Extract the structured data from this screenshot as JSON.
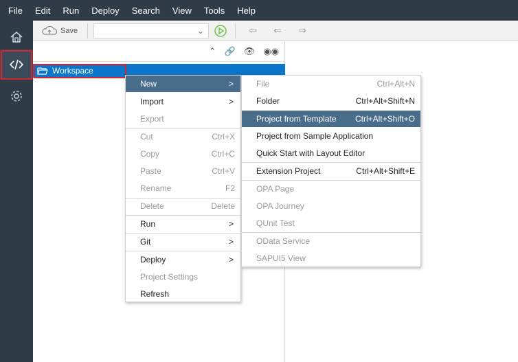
{
  "menubar": [
    "File",
    "Edit",
    "Run",
    "Deploy",
    "Search",
    "View",
    "Tools",
    "Help"
  ],
  "sidebar": {
    "icons": [
      "home-icon",
      "code-icon",
      "gear-icon"
    ],
    "active": "code-icon"
  },
  "toolbar": {
    "save_label": "Save",
    "run_config_value": ""
  },
  "tree": {
    "workspace_label": "Workspace"
  },
  "context_menu": [
    {
      "label": "New",
      "shortcut": "",
      "submenu": true,
      "enabled": true,
      "highlighted": true
    },
    {
      "label": "Import",
      "shortcut": "",
      "submenu": true,
      "enabled": true
    },
    {
      "label": "Export",
      "shortcut": "",
      "submenu": false,
      "enabled": false
    },
    {
      "label": "Cut",
      "shortcut": "Ctrl+X",
      "submenu": false,
      "enabled": false
    },
    {
      "label": "Copy",
      "shortcut": "Ctrl+C",
      "submenu": false,
      "enabled": false
    },
    {
      "label": "Paste",
      "shortcut": "Ctrl+V",
      "submenu": false,
      "enabled": false
    },
    {
      "label": "Rename",
      "shortcut": "F2",
      "submenu": false,
      "enabled": false
    },
    {
      "label": "Delete",
      "shortcut": "Delete",
      "submenu": false,
      "enabled": false
    },
    {
      "label": "Run",
      "shortcut": "",
      "submenu": true,
      "enabled": true
    },
    {
      "label": "Git",
      "shortcut": "",
      "submenu": true,
      "enabled": true
    },
    {
      "label": "Deploy",
      "shortcut": "",
      "submenu": true,
      "enabled": true
    },
    {
      "label": "Project Settings",
      "shortcut": "",
      "submenu": false,
      "enabled": false
    },
    {
      "label": "Refresh",
      "shortcut": "",
      "submenu": false,
      "enabled": true
    }
  ],
  "submenu": [
    {
      "label": "File",
      "shortcut": "Ctrl+Alt+N",
      "enabled": false
    },
    {
      "label": "Folder",
      "shortcut": "Ctrl+Alt+Shift+N",
      "enabled": true
    },
    {
      "label": "Project from Template",
      "shortcut": "Ctrl+Alt+Shift+O",
      "enabled": true,
      "highlighted": true
    },
    {
      "label": "Project from Sample Application",
      "shortcut": "",
      "enabled": true
    },
    {
      "label": "Quick Start with Layout Editor",
      "shortcut": "",
      "enabled": true
    },
    {
      "label": "Extension Project",
      "shortcut": "Ctrl+Alt+Shift+E",
      "enabled": true
    },
    {
      "label": "OPA Page",
      "shortcut": "",
      "enabled": false
    },
    {
      "label": "OPA Journey",
      "shortcut": "",
      "enabled": false
    },
    {
      "label": "QUnit Test",
      "shortcut": "",
      "enabled": false
    },
    {
      "label": "OData Service",
      "shortcut": "",
      "enabled": false
    },
    {
      "label": "SAPUI5 View",
      "shortcut": "",
      "enabled": false
    }
  ]
}
